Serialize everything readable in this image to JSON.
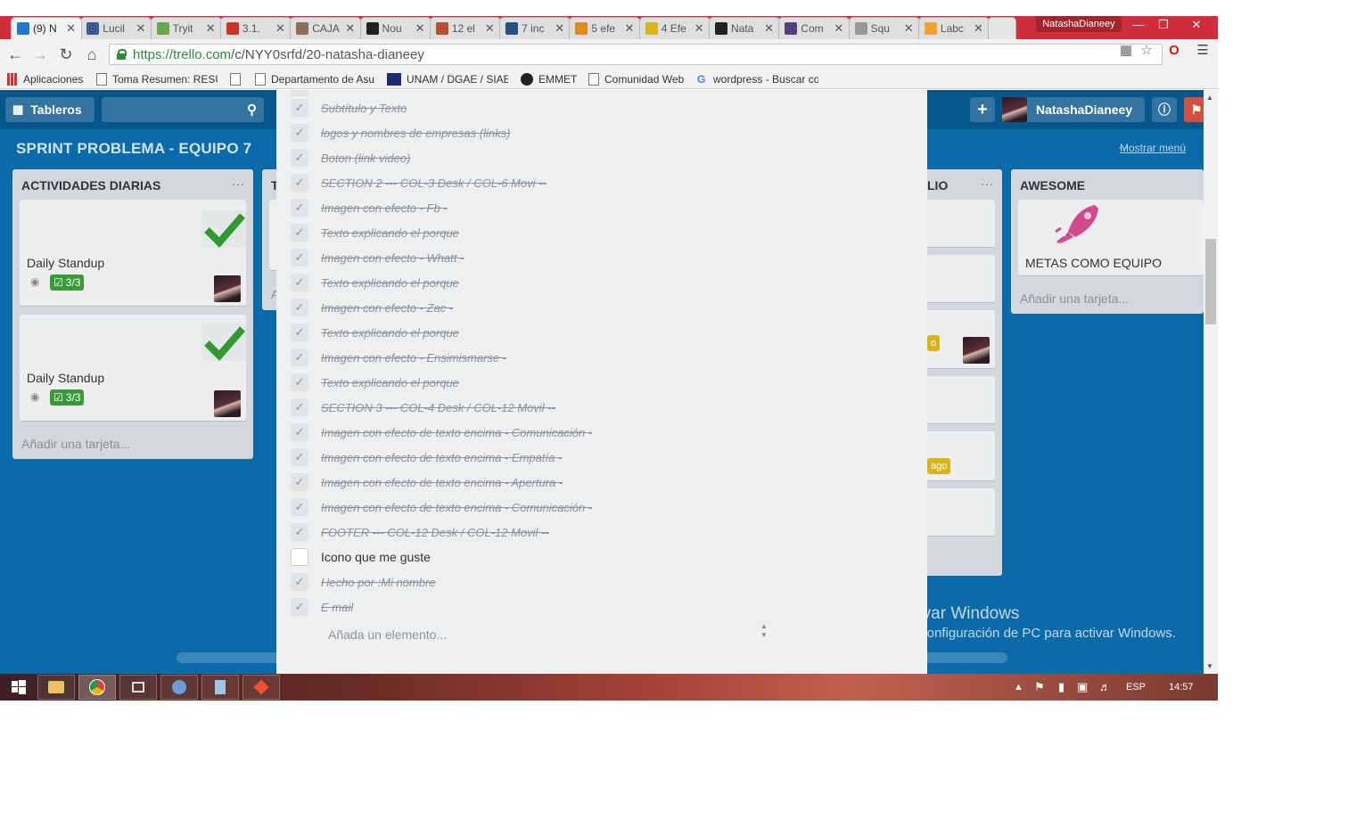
{
  "browser": {
    "profile_name": "NatashaDianeey",
    "tabs": [
      {
        "label": "(9) N",
        "icon": "trello-favicon",
        "color": "#1f7ac7",
        "active": true
      },
      {
        "label": "Lucil",
        "icon": "facebook-favicon",
        "color": "#3b5998"
      },
      {
        "label": "Tryit",
        "icon": "w3schools-favicon",
        "color": "#6aa84f"
      },
      {
        "label": "3.1. ",
        "icon": "ruby-favicon",
        "color": "#c8352b"
      },
      {
        "label": "CAJA",
        "icon": "document-favicon",
        "color": "#8a6d5a"
      },
      {
        "label": "Nou",
        "icon": "nou-favicon",
        "color": "#222222"
      },
      {
        "label": "12 el",
        "icon": "drop-favicon",
        "color": "#b5502e"
      },
      {
        "label": "7 inc",
        "icon": "mail-favicon",
        "color": "#2a4e80"
      },
      {
        "label": "5 efe",
        "icon": "swirl-favicon",
        "color": "#e08a1e"
      },
      {
        "label": "4 Efe",
        "icon": "yellow-favicon",
        "color": "#d9b51c"
      },
      {
        "label": "Nata",
        "icon": "github-favicon",
        "color": "#222222"
      },
      {
        "label": "Com",
        "icon": "bootstrap-favicon",
        "color": "#563d7c"
      },
      {
        "label": "Squ",
        "icon": "document-favicon",
        "color": "#999999"
      },
      {
        "label": "Labc",
        "icon": "lab-favicon",
        "color": "#f0a030"
      }
    ],
    "url_host": "https://trello.com",
    "url_path": "/c/NYY0srfd/20-natasha-dianeey",
    "bookmarks": [
      {
        "label": "Aplicaciones",
        "icon": "apps-grid-icon"
      },
      {
        "label": "Toma Resumen: RESU",
        "icon": "page-icon"
      },
      {
        "label": "",
        "icon": "page-icon"
      },
      {
        "label": "Departamento de Asu",
        "icon": "page-icon"
      },
      {
        "label": "UNAM / DGAE / SIAE",
        "icon": "unam-icon"
      },
      {
        "label": "EMMET",
        "icon": "emmet-icon"
      },
      {
        "label": "Comunidad Web",
        "icon": "page-icon"
      },
      {
        "label": "wordpress - Buscar co",
        "icon": "google-icon"
      }
    ]
  },
  "trello": {
    "boards_button": "Tableros",
    "user_name": "NatashaDianeey",
    "board_title": "SPRINT PROBLEMA - EQUIPO 7",
    "show_menu": "Mostrar menú",
    "lists": [
      {
        "title": "ACTIVIDADES DIARIAS",
        "cards": [
          {
            "title": "Daily Standup",
            "checklist": "3/3"
          },
          {
            "title": "Daily Standup",
            "checklist": "3/3"
          }
        ],
        "add_card": "Añadir una tarjeta..."
      },
      {
        "title": "T"
      },
      {
        "title": "LIO",
        "labels": [
          "o",
          "ago"
        ]
      },
      {
        "title": "AWESOME",
        "cards": [
          {
            "title": "METAS COMO EQUIPO"
          }
        ],
        "add_card": "Añadir una tarjeta..."
      }
    ],
    "checklist": {
      "items": [
        {
          "text": "Subtítulo y Texto",
          "done": true
        },
        {
          "text": "logos y nombres de empresas (links)",
          "done": true
        },
        {
          "text": "Boton (link video)",
          "done": true
        },
        {
          "text": "SECTION 2 --- COL-3 Desk / COL-6 Movi --",
          "done": true
        },
        {
          "text": "Imagen con efecto - Fb -",
          "done": true
        },
        {
          "text": "Texto explicando el porque",
          "done": true
        },
        {
          "text": "Imagen con efecto - Whatt -",
          "done": true
        },
        {
          "text": "Texto explicando el porque",
          "done": true
        },
        {
          "text": "Imagen con efecto - Zac -",
          "done": true
        },
        {
          "text": "Texto explicando el porque",
          "done": true
        },
        {
          "text": "Imagen con efecto - Ensimismarse -",
          "done": true
        },
        {
          "text": "Texto explicando el porque",
          "done": true
        },
        {
          "text": "SECTION 3 --- COL-4 Desk / COL-12 Movil --",
          "done": true
        },
        {
          "text": "Imagen con efecto de texto encima - Comunicación -",
          "done": true
        },
        {
          "text": "Imagen con efecto de texto encima - Empatía -",
          "done": true
        },
        {
          "text": "Imagen con efecto de texto encima - Apertura -",
          "done": true
        },
        {
          "text": "Imagen con efecto de texto encima - Comunicación -",
          "done": true
        },
        {
          "text": "FOOTER --- COL-12 Desk / COL-12 Movil --",
          "done": true
        },
        {
          "text": "Icono que me guste",
          "done": false
        },
        {
          "text": "Hecho por :Mi nombre",
          "done": true
        },
        {
          "text": "E mail",
          "done": true
        }
      ],
      "add_item_placeholder": "Añada un elemento..."
    }
  },
  "watermark": {
    "title": "Activar Windows",
    "subtitle": "Ir a Configuración de PC para activar Windows."
  },
  "taskbar": {
    "language": "ESP",
    "time": "14:57",
    "apps": [
      "windows-start-icon",
      "file-explorer-icon",
      "chrome-icon",
      "app-icon",
      "paint-icon",
      "notepad-icon",
      "git-icon"
    ]
  },
  "colors": {
    "trello_blue": "#0a6ba8",
    "trello_header": "#06558b",
    "chrome_red": "#cf2e3b",
    "badge_green": "#3a9a3a"
  }
}
